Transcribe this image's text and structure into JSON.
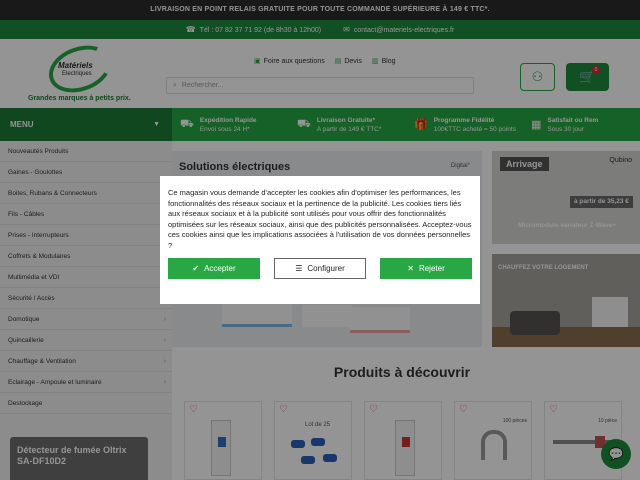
{
  "topbar": {
    "text": "LIVRAISON EN POINT RELAIS GRATUITE POUR TOUTE COMMANDE SUPÉRIEURE À 149 € TTC*."
  },
  "contact": {
    "phone": "Tél : 07 82 37 71 92 (de 8h30 à 12h00)",
    "email": "contact@materiels-electriques.fr"
  },
  "logo": {
    "line1": "Matériels",
    "line2": "Electriques",
    "tagline": "Grandes marques à petits prix."
  },
  "quicklinks": [
    {
      "icon": "question-icon",
      "label": "Foire aux questions"
    },
    {
      "icon": "document-icon",
      "label": "Devis"
    },
    {
      "icon": "blog-icon",
      "label": "Blog"
    }
  ],
  "search": {
    "placeholder": "Rechercher..."
  },
  "cart": {
    "count": "0"
  },
  "menu": {
    "label": "MENU"
  },
  "features": [
    {
      "icon": "truck-icon",
      "title": "Expédition Rapide",
      "sub": "Envoi sous 24 H*"
    },
    {
      "icon": "delivery-icon",
      "title": "Livraison Gratuite*",
      "sub": "A partir de 149 € TTC*"
    },
    {
      "icon": "gift-icon",
      "title": "Programme Fidélité",
      "sub": "100€TTC acheté = 50 points"
    },
    {
      "icon": "box-icon",
      "title": "Satisfait ou Rem",
      "sub": "Sous 30 jour"
    }
  ],
  "sidebar": {
    "items": [
      {
        "label": "Nouveautés Produits",
        "arrow": ""
      },
      {
        "label": "Gaines - Goulottes",
        "arrow": ""
      },
      {
        "label": "Boites, Rubans & Connecteurs",
        "arrow": ""
      },
      {
        "label": "Fils - Câbles",
        "arrow": ""
      },
      {
        "label": "Prises - Interrupteurs",
        "arrow": ""
      },
      {
        "label": "Coffrets & Modulaires",
        "arrow": ""
      },
      {
        "label": "Multimédia et VDI",
        "arrow": ""
      },
      {
        "label": "Sécurité / Accès",
        "arrow": ""
      },
      {
        "label": "Domotique",
        "arrow": "›"
      },
      {
        "label": "Quincaillerie",
        "arrow": "›"
      },
      {
        "label": "Chauffage & Ventilation",
        "arrow": "›"
      },
      {
        "label": "Eclairage - Ampoule et luminaire",
        "arrow": "›"
      },
      {
        "label": "Destockage",
        "arrow": ""
      }
    ],
    "banner": "Détecteur de fumée Oltrix SA-DF10D2"
  },
  "hero": {
    "title": "Solutions électriques",
    "logo": "Digital°"
  },
  "promo1": {
    "tag": "Arrivage",
    "price": "à partir de 35,23 €",
    "caption": "Micromodule variateur Z-Wave+",
    "brand": "Qubino"
  },
  "promo2": {
    "title": "CHAUFFEZ VOTRE LOGEMENT"
  },
  "section": {
    "title": "Produits à découvrir"
  },
  "products": [
    {
      "label": ""
    },
    {
      "label": "Lot de 25"
    },
    {
      "label": ""
    },
    {
      "label": "100 pièces"
    },
    {
      "label": "10 pièce"
    }
  ],
  "cookie": {
    "text": "Ce magasin vous demande d'accepter les cookies afin d'optimiser les performances, les fonctionnalités des réseaux sociaux et la pertinence de la publicité. Les cookies tiers liés aux réseaux sociaux et à la publicité sont utilisés pour vous offrir des fonctionnalités optimisées sur les réseaux sociaux, ainsi que des publicités personnalisées. Acceptez-vous ces cookies ainsi que les implications associées à l'utilisation de vos données personnelles ?",
    "accept": "Accepter",
    "configure": "Configurer",
    "reject": "Rejeter"
  },
  "colors": {
    "brand_green": "#27a844",
    "dark_green": "#1e7a34",
    "topbar": "#2b2b2b"
  }
}
